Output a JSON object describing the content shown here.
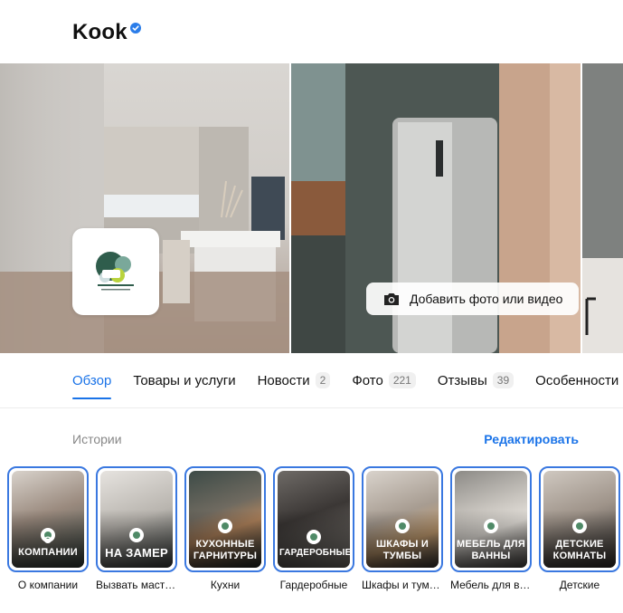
{
  "header": {
    "title": "Kook"
  },
  "gallery": {
    "add_media_label": "Добавить фото или видео"
  },
  "tabs": [
    {
      "label": "Обзор",
      "count": "",
      "active": true
    },
    {
      "label": "Товары и услуги",
      "count": ""
    },
    {
      "label": "Новости",
      "count": "2"
    },
    {
      "label": "Фото",
      "count": "221"
    },
    {
      "label": "Отзывы",
      "count": "39"
    },
    {
      "label": "Особенности",
      "count": ""
    }
  ],
  "stories": {
    "label": "Истории",
    "edit_label": "Редактировать",
    "items": [
      {
        "overlay": "О КОМПАНИИ",
        "caption": "О компании"
      },
      {
        "overlay": "НА ЗАМЕР",
        "caption": "Вызвать мастера"
      },
      {
        "overlay": "КУХОННЫЕ ГАРНИТУРЫ",
        "caption": "Кухни"
      },
      {
        "overlay": "ГАРДЕРОБНЫЕ",
        "caption": "Гардеробные"
      },
      {
        "overlay": "ШКАФЫ И ТУМБЫ",
        "caption": "Шкафы и тумбы"
      },
      {
        "overlay": "МЕБЕЛЬ ДЛЯ ВАННЫ",
        "caption": "Мебель для ванны"
      },
      {
        "overlay": "ДЕТСКИЕ КОМНАТЫ",
        "caption": "Детские"
      }
    ]
  },
  "colors": {
    "accent": "#1a73e8",
    "story_ring": "#3a78e0",
    "verified": "#2b7de9"
  }
}
